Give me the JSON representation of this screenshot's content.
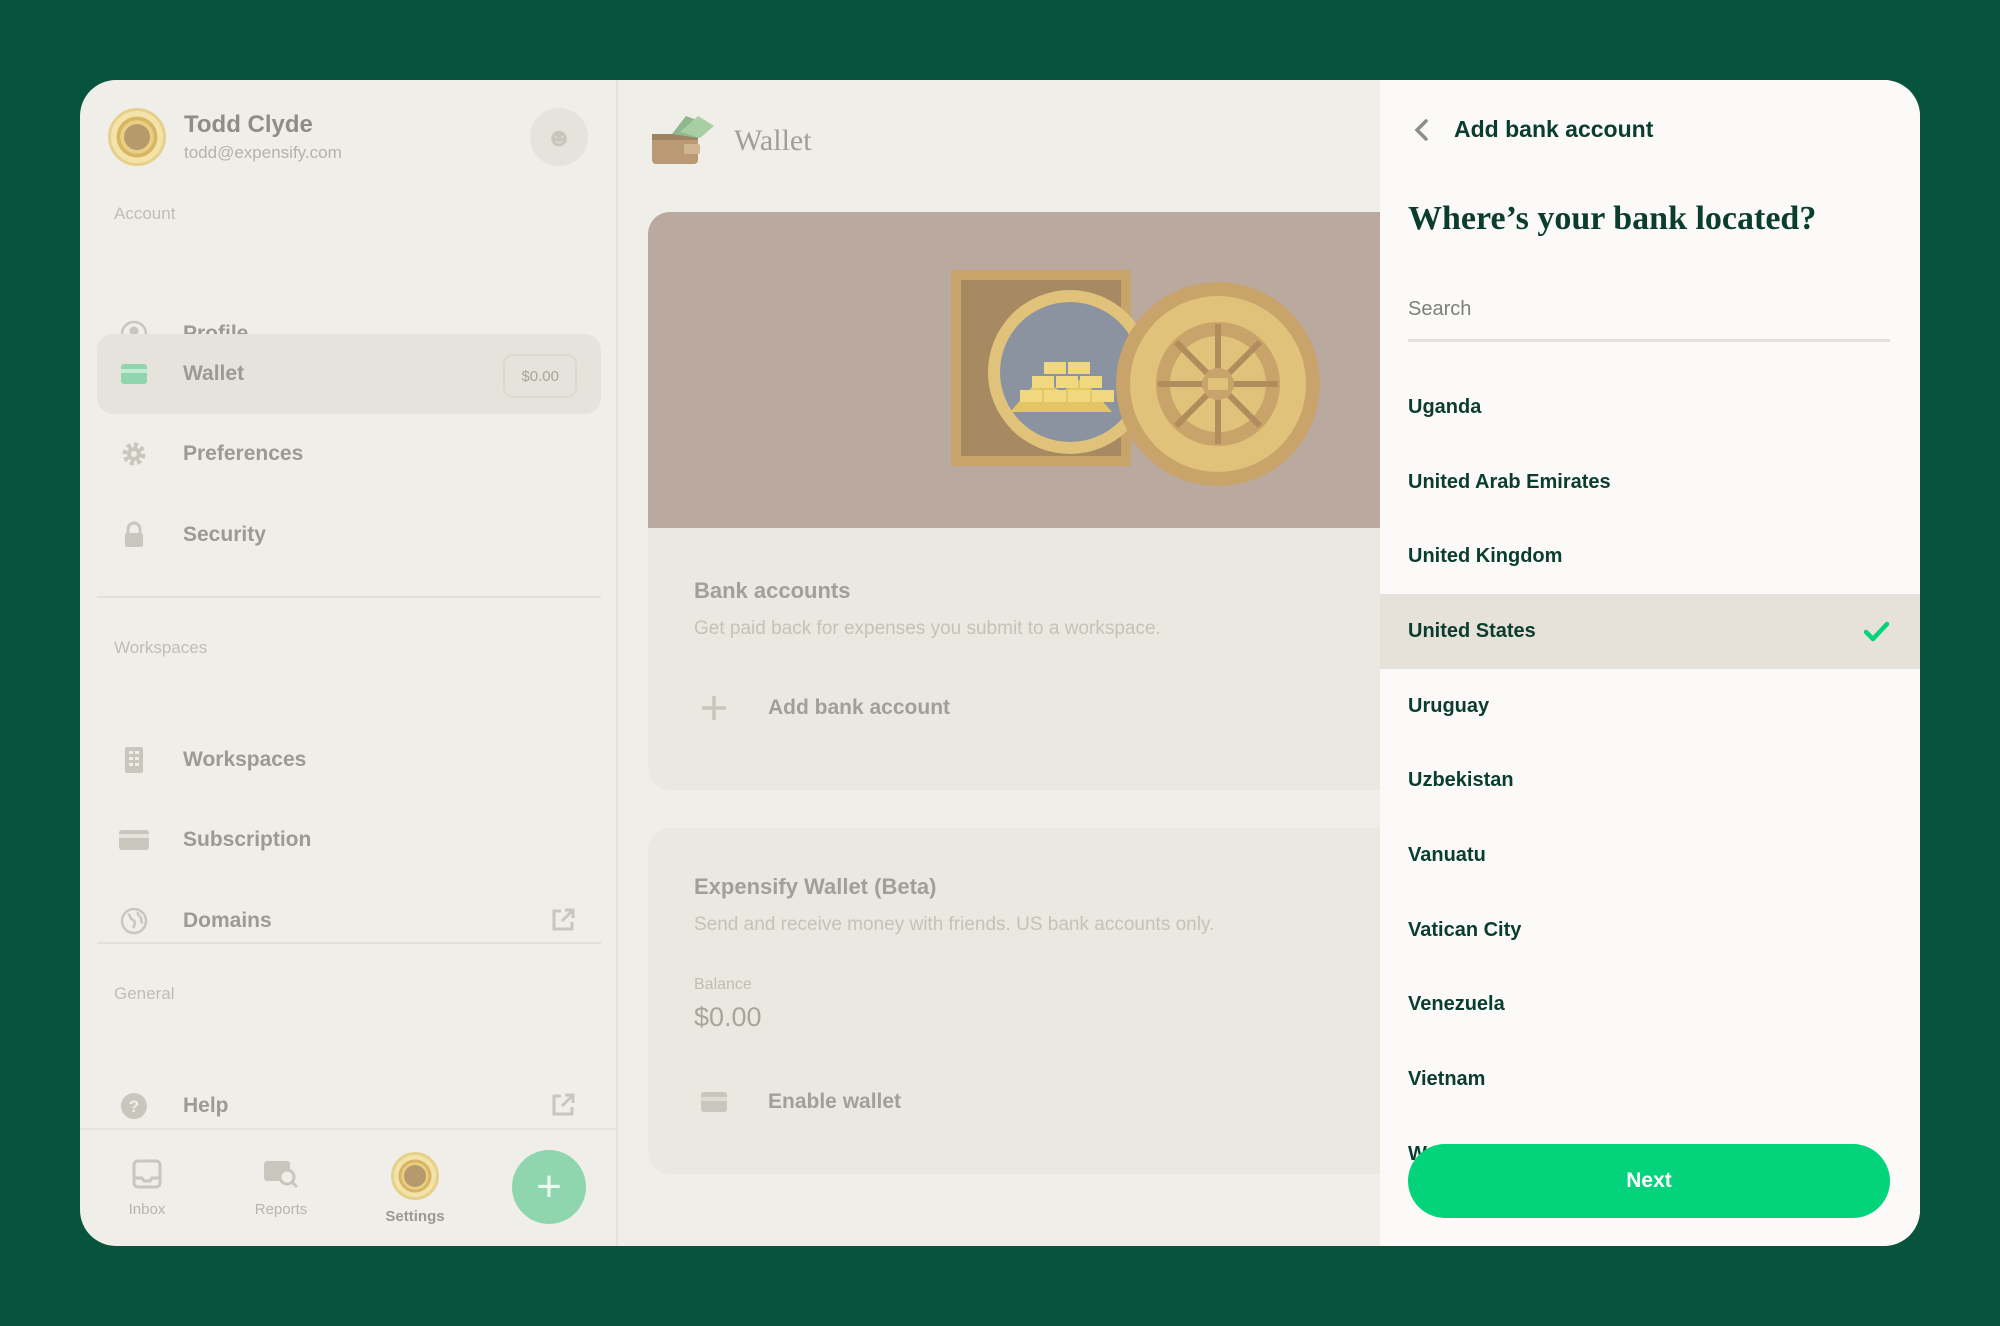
{
  "profile": {
    "name": "Todd Clyde",
    "email": "todd@expensify.com"
  },
  "sidebar": {
    "sections": {
      "account": "Account",
      "workspaces": "Workspaces",
      "general": "General"
    },
    "items": {
      "profile": "Profile",
      "wallet": "Wallet",
      "wallet_badge": "$0.00",
      "preferences": "Preferences",
      "security": "Security",
      "workspaces": "Workspaces",
      "subscription": "Subscription",
      "domains": "Domains",
      "help": "Help"
    }
  },
  "bottom_nav": {
    "inbox": "Inbox",
    "reports": "Reports",
    "settings": "Settings"
  },
  "main": {
    "title": "Wallet",
    "bank_accounts": {
      "title": "Bank accounts",
      "subtitle": "Get paid back for expenses you submit to a workspace.",
      "action": "Add bank account"
    },
    "expensify_wallet": {
      "title": "Expensify Wallet (Beta)",
      "subtitle": "Send and receive money with friends. US bank accounts only.",
      "balance_label": "Balance",
      "balance_value": "$0.00",
      "action": "Enable wallet"
    }
  },
  "panel": {
    "title": "Add bank account",
    "question": "Where’s your bank located?",
    "search_placeholder": "Search",
    "countries": [
      "Uganda",
      "United Arab Emirates",
      "United Kingdom",
      "United States",
      "Uruguay",
      "Uzbekistan",
      "Vanuatu",
      "Vatican City",
      "Venezuela",
      "Vietnam",
      "Wallis & Futuna"
    ],
    "selected_index": 3,
    "next_label": "Next"
  },
  "colors": {
    "brand_green": "#03d47c",
    "dark_green": "#0a3d2e",
    "background": "#08533b"
  },
  "icons": [
    "avatar",
    "emoji-icon",
    "profile-icon",
    "wallet-icon",
    "gear-icon",
    "lock-icon",
    "building-icon",
    "credit-card-icon",
    "globe-icon",
    "external-link-icon",
    "help-icon",
    "inbox-icon",
    "reports-icon",
    "plus-icon",
    "back-chevron-icon",
    "checkmark-icon",
    "vault-illustration"
  ]
}
